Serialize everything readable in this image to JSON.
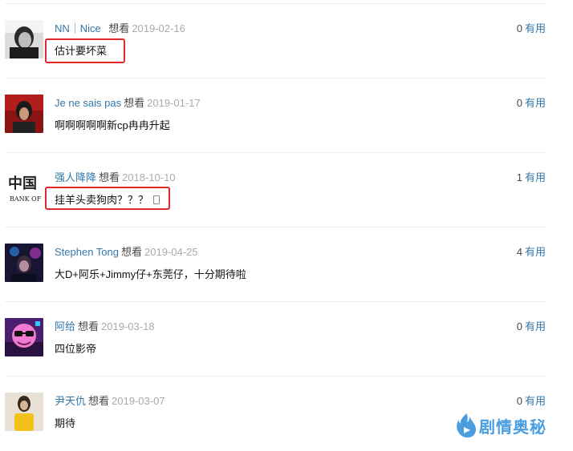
{
  "comments": [
    {
      "user": "NN｜Nice ",
      "status": "想看",
      "date": "2019-02-16",
      "count": "0",
      "useful": "有用",
      "text": "估计要坏菜",
      "highlighted": true
    },
    {
      "user": "Je ne sais pas",
      "status": "想看",
      "date": "2019-01-17",
      "count": "0",
      "useful": "有用",
      "text": "啊啊啊啊啊新cp冉冉升起",
      "highlighted": false
    },
    {
      "user": "强人降降",
      "status": "想看",
      "date": "2018-10-10",
      "count": "1",
      "useful": "有用",
      "text": "挂羊头卖狗肉？？？",
      "avatar_text": "中国",
      "avatar_subtext": "BANK OF",
      "highlighted": true
    },
    {
      "user": "Stephen Tong",
      "status": "想看",
      "date": "2019-04-25",
      "count": "4",
      "useful": "有用",
      "text": "大D+阿乐+Jimmy仔+东莞仔，十分期待啦",
      "highlighted": false
    },
    {
      "user": "阿给",
      "status": "想看",
      "date": "2019-03-18",
      "count": "0",
      "useful": "有用",
      "text": "四位影帝",
      "highlighted": false
    },
    {
      "user": "尹天仇",
      "status": "想看",
      "date": "2019-03-07",
      "count": "0",
      "useful": "有用",
      "text": "期待",
      "highlighted": false
    }
  ],
  "watermark": {
    "text": "剧情奥秘",
    "color": "#4a9ee0"
  },
  "colors": {
    "link": "#3377aa",
    "date": "#aaaaaa",
    "highlight": "#e02a2a"
  }
}
